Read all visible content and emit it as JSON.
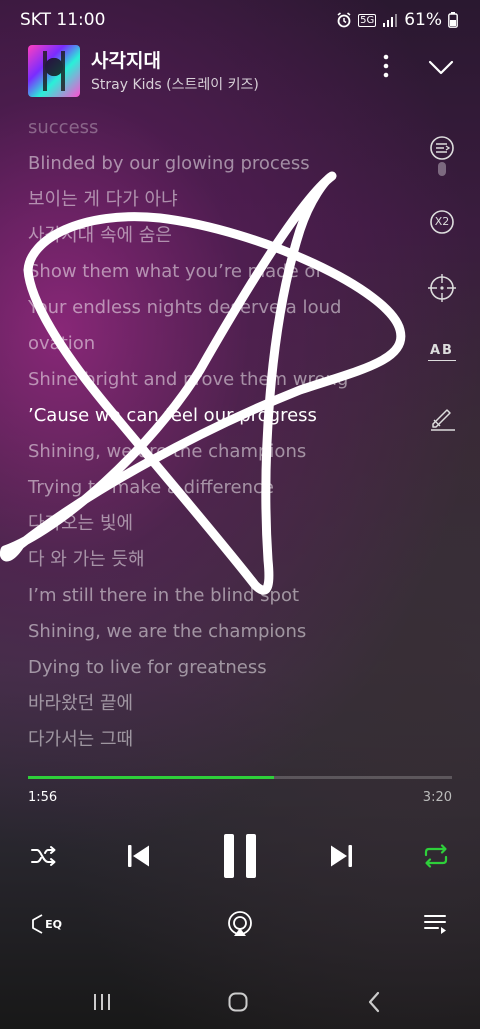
{
  "status": {
    "carrier_time": "SKT 11:00",
    "network": "5G",
    "battery": "61%"
  },
  "track": {
    "title": "사각지대",
    "artist": "Stray Kids (스트레이 키즈)"
  },
  "lyrics": [
    {
      "text": "success",
      "state": "dim"
    },
    {
      "text": "Blinded by our glowing process",
      "state": "normal"
    },
    {
      "text": "보이는 게 다가 아냐",
      "state": "normal"
    },
    {
      "text": "사각지대 속에 숨은",
      "state": "normal"
    },
    {
      "text": "Show them what you’re made of",
      "state": "normal"
    },
    {
      "text": "Your endless nights deserve a loud",
      "state": "normal"
    },
    {
      "text": "ovation",
      "state": "normal"
    },
    {
      "text": "Shine bright and prove them wrong",
      "state": "normal"
    },
    {
      "text": "’Cause we can feel our progress",
      "state": "active"
    },
    {
      "text": "Shining, we are the champions",
      "state": "normal"
    },
    {
      "text": "Trying to make a difference",
      "state": "normal"
    },
    {
      "text": "다가오는 빛에",
      "state": "normal"
    },
    {
      "text": "다 와 가는 듯해",
      "state": "normal"
    },
    {
      "text": "I’m still there in the blind spot",
      "state": "normal"
    },
    {
      "text": "Shining, we are the champions",
      "state": "normal"
    },
    {
      "text": "Dying to live for greatness",
      "state": "normal"
    },
    {
      "text": "바라왔던 끝에",
      "state": "normal"
    },
    {
      "text": "다가서는 그때",
      "state": "normal"
    }
  ],
  "side_tools": [
    {
      "name": "lyrics-scroll-icon"
    },
    {
      "name": "speed-x2-icon",
      "label": "X2"
    },
    {
      "name": "target-icon"
    },
    {
      "name": "text-size-icon",
      "label": "AB"
    },
    {
      "name": "pen-draw-icon"
    }
  ],
  "playback": {
    "elapsed": "1:56",
    "total": "3:20",
    "progress": 0.58
  },
  "colors": {
    "accent": "#2ed03a"
  },
  "controls": [
    "shuffle-icon",
    "previous-icon",
    "pause-icon",
    "next-icon",
    "repeat-icon"
  ],
  "bottom_tools": {
    "eq_label": "EQ"
  }
}
